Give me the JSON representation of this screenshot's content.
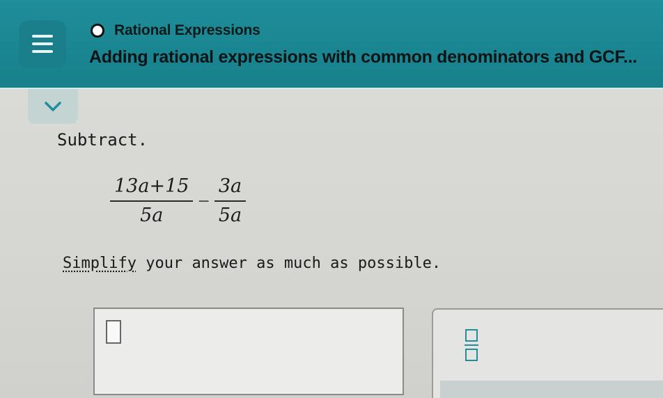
{
  "header": {
    "topic": "Rational Expressions",
    "title": "Adding rational expressions with common denominators and GCF..."
  },
  "icons": {
    "menu": "hamburger-menu-icon",
    "status": "status-circle-icon",
    "collapse": "chevron-down-icon",
    "fraction": "fraction-template-icon"
  },
  "colors": {
    "header": "#1f8e9a",
    "accent": "#1f8e9a"
  },
  "problem": {
    "instruction": "Subtract.",
    "term1": {
      "numerator": "13a+15",
      "denominator": "5a"
    },
    "operator": "−",
    "term2": {
      "numerator": "3a",
      "denominator": "5a"
    },
    "simplify_link": "Simplify",
    "simplify_rest": " your answer as much as possible."
  },
  "answer": {
    "value": ""
  }
}
